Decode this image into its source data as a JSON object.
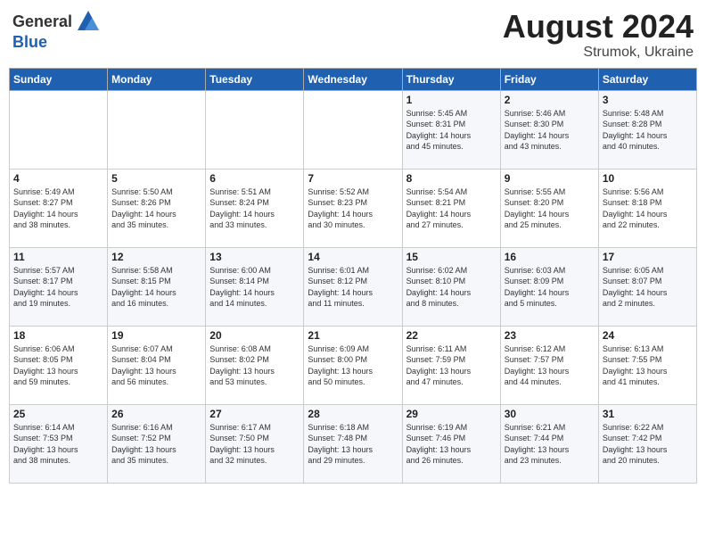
{
  "header": {
    "logo_general": "General",
    "logo_blue": "Blue",
    "month_year": "August 2024",
    "location": "Strumok, Ukraine"
  },
  "days_of_week": [
    "Sunday",
    "Monday",
    "Tuesday",
    "Wednesday",
    "Thursday",
    "Friday",
    "Saturday"
  ],
  "weeks": [
    [
      {
        "day": "",
        "detail": ""
      },
      {
        "day": "",
        "detail": ""
      },
      {
        "day": "",
        "detail": ""
      },
      {
        "day": "",
        "detail": ""
      },
      {
        "day": "1",
        "detail": "Sunrise: 5:45 AM\nSunset: 8:31 PM\nDaylight: 14 hours\nand 45 minutes."
      },
      {
        "day": "2",
        "detail": "Sunrise: 5:46 AM\nSunset: 8:30 PM\nDaylight: 14 hours\nand 43 minutes."
      },
      {
        "day": "3",
        "detail": "Sunrise: 5:48 AM\nSunset: 8:28 PM\nDaylight: 14 hours\nand 40 minutes."
      }
    ],
    [
      {
        "day": "4",
        "detail": "Sunrise: 5:49 AM\nSunset: 8:27 PM\nDaylight: 14 hours\nand 38 minutes."
      },
      {
        "day": "5",
        "detail": "Sunrise: 5:50 AM\nSunset: 8:26 PM\nDaylight: 14 hours\nand 35 minutes."
      },
      {
        "day": "6",
        "detail": "Sunrise: 5:51 AM\nSunset: 8:24 PM\nDaylight: 14 hours\nand 33 minutes."
      },
      {
        "day": "7",
        "detail": "Sunrise: 5:52 AM\nSunset: 8:23 PM\nDaylight: 14 hours\nand 30 minutes."
      },
      {
        "day": "8",
        "detail": "Sunrise: 5:54 AM\nSunset: 8:21 PM\nDaylight: 14 hours\nand 27 minutes."
      },
      {
        "day": "9",
        "detail": "Sunrise: 5:55 AM\nSunset: 8:20 PM\nDaylight: 14 hours\nand 25 minutes."
      },
      {
        "day": "10",
        "detail": "Sunrise: 5:56 AM\nSunset: 8:18 PM\nDaylight: 14 hours\nand 22 minutes."
      }
    ],
    [
      {
        "day": "11",
        "detail": "Sunrise: 5:57 AM\nSunset: 8:17 PM\nDaylight: 14 hours\nand 19 minutes."
      },
      {
        "day": "12",
        "detail": "Sunrise: 5:58 AM\nSunset: 8:15 PM\nDaylight: 14 hours\nand 16 minutes."
      },
      {
        "day": "13",
        "detail": "Sunrise: 6:00 AM\nSunset: 8:14 PM\nDaylight: 14 hours\nand 14 minutes."
      },
      {
        "day": "14",
        "detail": "Sunrise: 6:01 AM\nSunset: 8:12 PM\nDaylight: 14 hours\nand 11 minutes."
      },
      {
        "day": "15",
        "detail": "Sunrise: 6:02 AM\nSunset: 8:10 PM\nDaylight: 14 hours\nand 8 minutes."
      },
      {
        "day": "16",
        "detail": "Sunrise: 6:03 AM\nSunset: 8:09 PM\nDaylight: 14 hours\nand 5 minutes."
      },
      {
        "day": "17",
        "detail": "Sunrise: 6:05 AM\nSunset: 8:07 PM\nDaylight: 14 hours\nand 2 minutes."
      }
    ],
    [
      {
        "day": "18",
        "detail": "Sunrise: 6:06 AM\nSunset: 8:05 PM\nDaylight: 13 hours\nand 59 minutes."
      },
      {
        "day": "19",
        "detail": "Sunrise: 6:07 AM\nSunset: 8:04 PM\nDaylight: 13 hours\nand 56 minutes."
      },
      {
        "day": "20",
        "detail": "Sunrise: 6:08 AM\nSunset: 8:02 PM\nDaylight: 13 hours\nand 53 minutes."
      },
      {
        "day": "21",
        "detail": "Sunrise: 6:09 AM\nSunset: 8:00 PM\nDaylight: 13 hours\nand 50 minutes."
      },
      {
        "day": "22",
        "detail": "Sunrise: 6:11 AM\nSunset: 7:59 PM\nDaylight: 13 hours\nand 47 minutes."
      },
      {
        "day": "23",
        "detail": "Sunrise: 6:12 AM\nSunset: 7:57 PM\nDaylight: 13 hours\nand 44 minutes."
      },
      {
        "day": "24",
        "detail": "Sunrise: 6:13 AM\nSunset: 7:55 PM\nDaylight: 13 hours\nand 41 minutes."
      }
    ],
    [
      {
        "day": "25",
        "detail": "Sunrise: 6:14 AM\nSunset: 7:53 PM\nDaylight: 13 hours\nand 38 minutes."
      },
      {
        "day": "26",
        "detail": "Sunrise: 6:16 AM\nSunset: 7:52 PM\nDaylight: 13 hours\nand 35 minutes."
      },
      {
        "day": "27",
        "detail": "Sunrise: 6:17 AM\nSunset: 7:50 PM\nDaylight: 13 hours\nand 32 minutes."
      },
      {
        "day": "28",
        "detail": "Sunrise: 6:18 AM\nSunset: 7:48 PM\nDaylight: 13 hours\nand 29 minutes."
      },
      {
        "day": "29",
        "detail": "Sunrise: 6:19 AM\nSunset: 7:46 PM\nDaylight: 13 hours\nand 26 minutes."
      },
      {
        "day": "30",
        "detail": "Sunrise: 6:21 AM\nSunset: 7:44 PM\nDaylight: 13 hours\nand 23 minutes."
      },
      {
        "day": "31",
        "detail": "Sunrise: 6:22 AM\nSunset: 7:42 PM\nDaylight: 13 hours\nand 20 minutes."
      }
    ]
  ]
}
